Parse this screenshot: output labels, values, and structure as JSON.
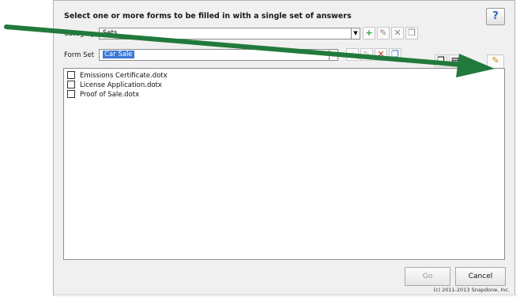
{
  "dialog": {
    "header": "Select one or more forms to be filled in with a single set of answers",
    "help_label": "?"
  },
  "category": {
    "label": "Category",
    "value": "Sets"
  },
  "form_set": {
    "label": "Form Set",
    "value": "Car Sale"
  },
  "forms": [
    {
      "label": "Emissions Certificate.dotx",
      "checked": false
    },
    {
      "label": "License Application.dotx",
      "checked": false
    },
    {
      "label": "Proof of Sale.dotx",
      "checked": false
    }
  ],
  "footer": {
    "go_label": "Go",
    "cancel_label": "Cancel",
    "copyright": "(c) 2011-2013 Snapdone, Inc."
  },
  "colors": {
    "annotation_arrow": "#217a3c",
    "selection": "#3a78d4",
    "add_icon": "#2eaa2e",
    "delete_icon": "#c8302c"
  },
  "icons": [
    "dropdown-arrow-icon",
    "add-icon",
    "edit-pencil-icon",
    "delete-x-icon",
    "copy-icon",
    "help-icon"
  ]
}
